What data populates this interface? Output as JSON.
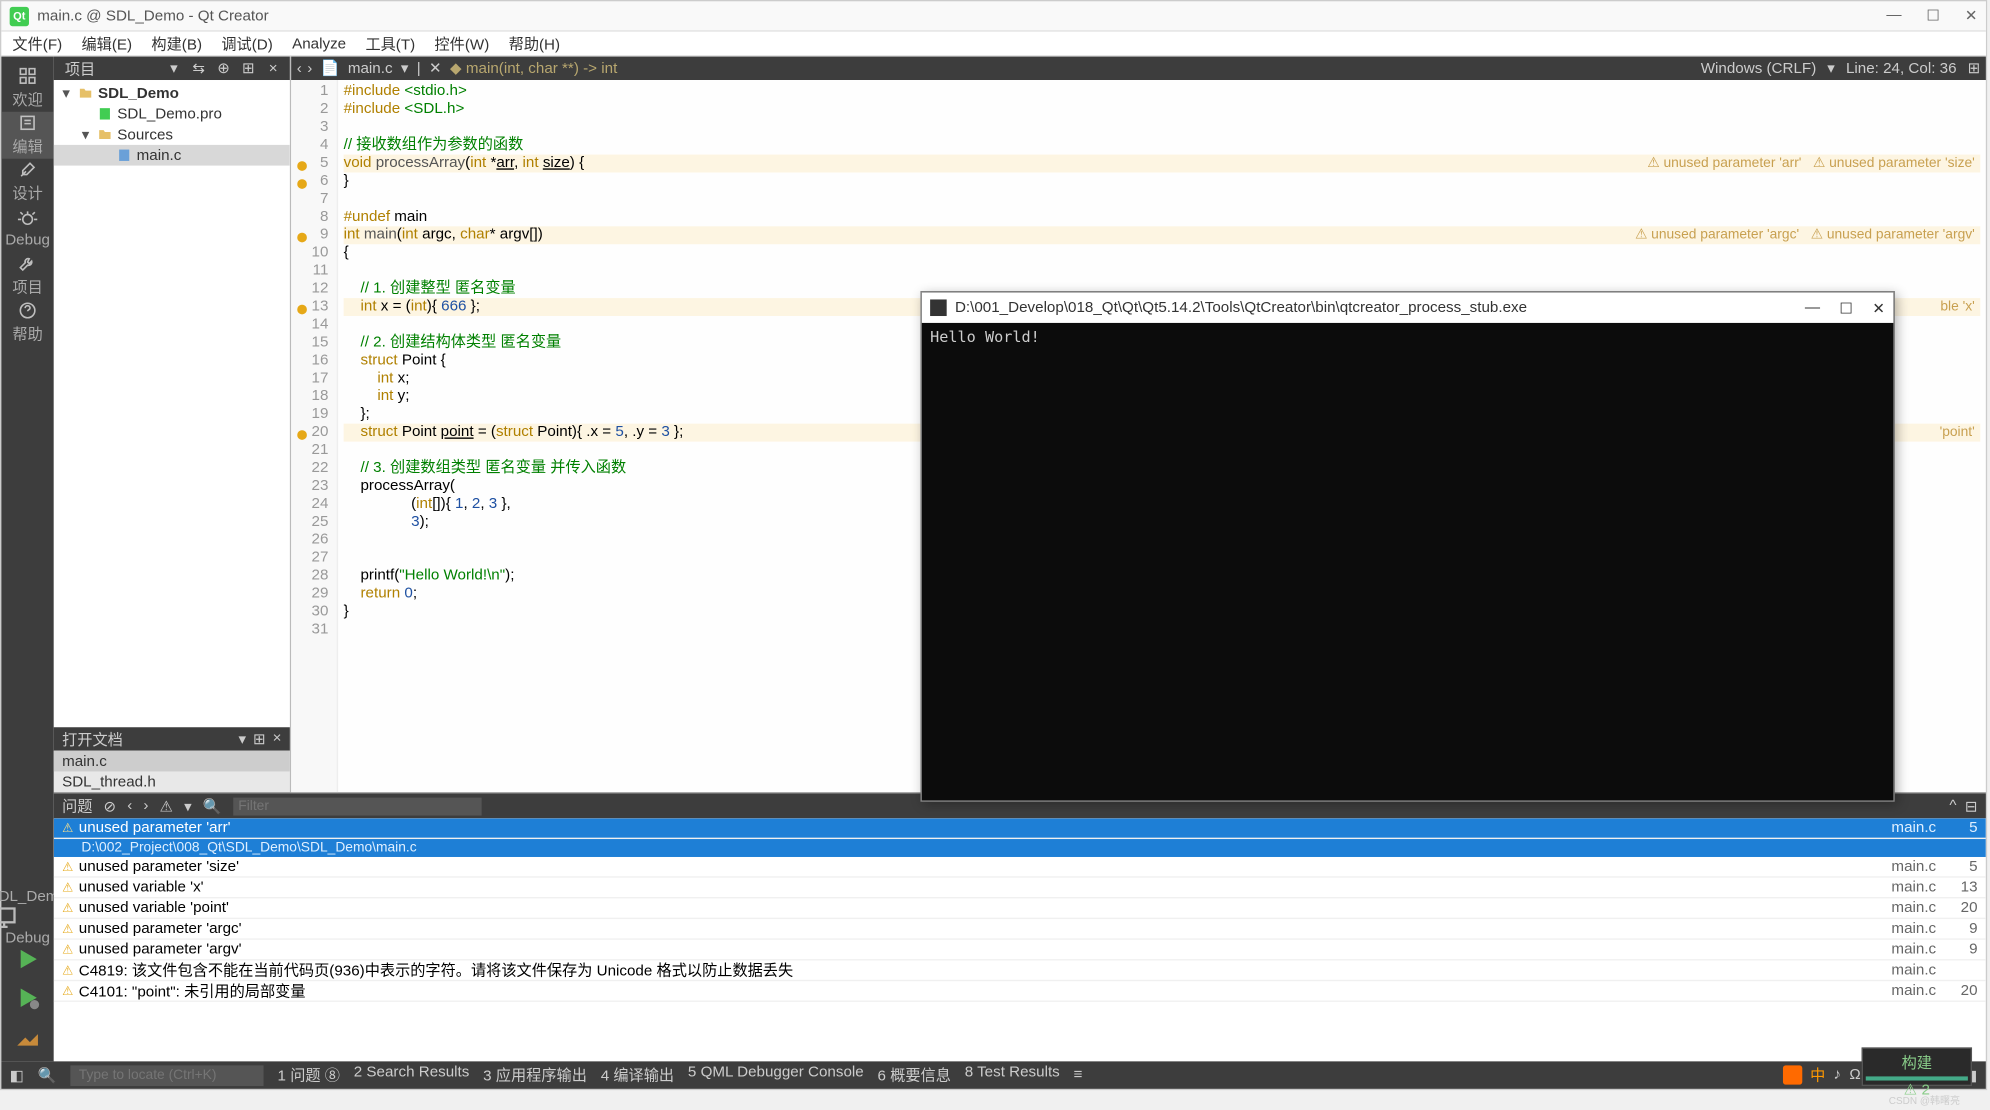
{
  "title": "main.c @ SDL_Demo - Qt Creator",
  "menu": [
    "文件(F)",
    "编辑(E)",
    "构建(B)",
    "调试(D)",
    "Analyze",
    "工具(T)",
    "控件(W)",
    "帮助(H)"
  ],
  "leftbar": [
    {
      "label": "欢迎",
      "icon": "grid"
    },
    {
      "label": "编辑",
      "icon": "edit",
      "active": true
    },
    {
      "label": "设计",
      "icon": "design"
    },
    {
      "label": "Debug",
      "icon": "bug"
    },
    {
      "label": "项目",
      "icon": "wrench"
    },
    {
      "label": "帮助",
      "icon": "help"
    }
  ],
  "kit": {
    "name": "SDL_Demo",
    "mode": "Debug"
  },
  "project_header": "项目",
  "tree": [
    {
      "depth": 0,
      "expand": "▾",
      "icon": "folder",
      "label": "SDL_Demo",
      "bold": true
    },
    {
      "depth": 1,
      "expand": "",
      "icon": "qtfile",
      "label": "SDL_Demo.pro"
    },
    {
      "depth": 1,
      "expand": "▾",
      "icon": "folder",
      "label": "Sources"
    },
    {
      "depth": 2,
      "expand": "",
      "icon": "cfile",
      "label": "main.c",
      "sel": true
    }
  ],
  "open_header": "打开文档",
  "open_files": [
    {
      "name": "main.c",
      "sel": true
    },
    {
      "name": "SDL_thread.h"
    }
  ],
  "crumb_file": "main.c",
  "crumb_func": "main(int, char **) -> int",
  "encoding": "Windows (CRLF)",
  "cursor": "Line: 24, Col: 36",
  "code": [
    {
      "n": 1,
      "html": "<span class='kw'>#include</span> <span class='inc'>&lt;stdio.h&gt;</span>"
    },
    {
      "n": 2,
      "html": "<span class='kw'>#include</span> <span class='inc'>&lt;SDL.h&gt;</span>"
    },
    {
      "n": 3,
      "html": ""
    },
    {
      "n": 4,
      "html": "<span class='cm'>// 接收数组作为参数的函数</span>"
    },
    {
      "n": 5,
      "warn": true,
      "cls": "warnline",
      "html": "<span class='ty'>void</span> <span class='fn'>processArray</span>(<span class='ty'>int</span> *<u>arr</u>, <span class='ty'>int</span> <u>size</u>) {",
      "inline": "⚠ unused parameter 'arr'   ⚠ unused parameter 'size'"
    },
    {
      "n": 6,
      "warn": true,
      "html": "}"
    },
    {
      "n": 7,
      "html": ""
    },
    {
      "n": 8,
      "html": "<span class='kw'>#undef</span> main"
    },
    {
      "n": 9,
      "warn": true,
      "cls": "warnline",
      "html": "<span class='ty'>int</span> <span class='fn'>main</span>(<span class='ty'>int</span> argc, <span class='ty'>char</span>* argv[])",
      "inline": "⚠ unused parameter 'argc'   ⚠ unused parameter 'argv'"
    },
    {
      "n": 10,
      "html": "{"
    },
    {
      "n": 11,
      "html": ""
    },
    {
      "n": 12,
      "html": "    <span class='cm'>// 1. 创建整型 匿名变量</span>"
    },
    {
      "n": 13,
      "warn": true,
      "cls": "warnline",
      "html": "    <span class='ty'>int</span> x = (<span class='ty'>int</span>){ <span class='num'>666</span> };",
      "inline": "ble 'x'"
    },
    {
      "n": 14,
      "html": ""
    },
    {
      "n": 15,
      "html": "    <span class='cm'>// 2. 创建结构体类型 匿名变量</span>"
    },
    {
      "n": 16,
      "html": "    <span class='ty'>struct</span> Point {"
    },
    {
      "n": 17,
      "html": "        <span class='ty'>int</span> x;"
    },
    {
      "n": 18,
      "html": "        <span class='ty'>int</span> y;"
    },
    {
      "n": 19,
      "html": "    };"
    },
    {
      "n": 20,
      "warn": true,
      "cls": "warnline",
      "html": "    <span class='ty'>struct</span> Point <u>point</u> = (<span class='ty'>struct</span> Point){ .x = <span class='num'>5</span>, .y = <span class='num'>3</span> };",
      "inline": "'point'"
    },
    {
      "n": 21,
      "html": ""
    },
    {
      "n": 22,
      "html": "    <span class='cm'>// 3. 创建数组类型 匿名变量 并传入函数</span>"
    },
    {
      "n": 23,
      "html": "    processArray("
    },
    {
      "n": 24,
      "html": "                (<span class='ty'>int</span>[]){ <span class='num'>1</span>, <span class='num'>2</span>, <span class='num'>3</span> },"
    },
    {
      "n": 25,
      "html": "                <span class='num'>3</span>);"
    },
    {
      "n": 26,
      "html": ""
    },
    {
      "n": 27,
      "html": ""
    },
    {
      "n": 28,
      "html": "    printf(<span class='str'>\"Hello World!\\n\"</span>);"
    },
    {
      "n": 29,
      "html": "    <span class='kw'>return</span> <span class='num'>0</span>;"
    },
    {
      "n": 30,
      "html": "}"
    },
    {
      "n": 31,
      "html": ""
    }
  ],
  "issues_header": "问题",
  "filter_placeholder": "Filter",
  "issues": [
    {
      "sel": true,
      "text": "unused parameter 'arr'",
      "file": "main.c",
      "line": 5,
      "sub": "D:\\002_Project\\008_Qt\\SDL_Demo\\SDL_Demo\\main.c"
    },
    {
      "text": "unused parameter 'size'",
      "file": "main.c",
      "line": 5
    },
    {
      "text": "unused variable 'x'",
      "file": "main.c",
      "line": 13
    },
    {
      "text": "unused variable 'point'",
      "file": "main.c",
      "line": 20
    },
    {
      "text": "unused parameter 'argc'",
      "file": "main.c",
      "line": 9
    },
    {
      "text": "unused parameter 'argv'",
      "file": "main.c",
      "line": 9
    },
    {
      "text": "C4819: 该文件包含不能在当前代码页(936)中表示的字符。请将该文件保存为 Unicode 格式以防止数据丢失",
      "file": "main.c",
      "line": ""
    },
    {
      "text": "C4101: \"point\": 未引用的局部变量",
      "file": "main.c",
      "line": 20
    }
  ],
  "build": {
    "label": "构建",
    "warn": "⚠ 2"
  },
  "status": {
    "locator_placeholder": "Type to locate (Ctrl+K)",
    "panes": [
      "1 问题 ⑧",
      "2 Search Results",
      "3 应用程序输出",
      "4 编译输出",
      "5 QML Debugger Console",
      "6 概要信息",
      "8 Test Results"
    ]
  },
  "console": {
    "title": "D:\\001_Develop\\018_Qt\\Qt\\Qt5.14.2\\Tools\\QtCreator\\bin\\qtcreator_process_stub.exe",
    "output": "Hello World!"
  },
  "watermark": "CSDN @韩曙亮"
}
